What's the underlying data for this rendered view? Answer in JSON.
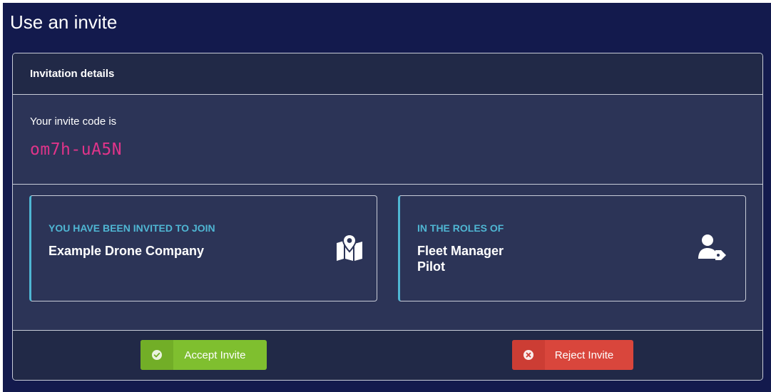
{
  "page": {
    "title": "Use an invite"
  },
  "card": {
    "header_title": "Invitation details",
    "code_label": "Your invite code is",
    "code_value": "om7h-uA5N"
  },
  "organization": {
    "heading": "YOU HAVE BEEN INVITED TO JOIN",
    "name": "Example Drone Company",
    "icon": "map-marker-icon"
  },
  "roles": {
    "heading": "IN THE ROLES OF",
    "items": [
      "Fleet Manager",
      "Pilot"
    ],
    "icon": "user-tag-icon"
  },
  "actions": {
    "accept_label": "Accept Invite",
    "accept_icon": "check-circle-icon",
    "reject_label": "Reject Invite",
    "reject_icon": "times-circle-icon"
  },
  "colors": {
    "background": "#131a4d",
    "card": "#2c3457",
    "card_header": "#212947",
    "accent": "#4fb6d3",
    "code": "#e0348a",
    "accept": "#7fbf2f",
    "reject": "#d9463c"
  }
}
